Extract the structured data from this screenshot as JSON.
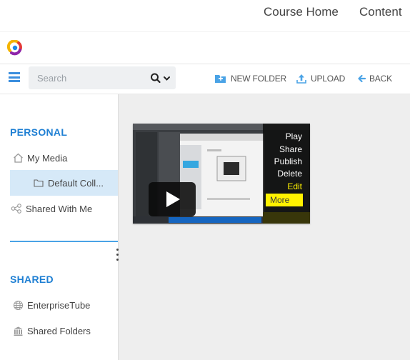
{
  "topnav": {
    "course_home": "Course Home",
    "content": "Content"
  },
  "toolbar": {
    "search_placeholder": "Search",
    "new_folder": "NEW FOLDER",
    "upload": "UPLOAD",
    "back": "BACK"
  },
  "sidebar": {
    "personal_title": "PERSONAL",
    "my_media": "My Media",
    "default_collection": "Default Coll...",
    "shared_with_me": "Shared With Me",
    "shared_title": "SHARED",
    "enterprise_tube": "EnterpriseTube",
    "shared_folders": "Shared Folders"
  },
  "media_tile": {
    "menu": {
      "play": "Play",
      "share": "Share",
      "publish": "Publish",
      "delete": "Delete",
      "edit": "Edit",
      "more": "More"
    }
  },
  "colors": {
    "accent": "#1e7fd3",
    "selected_bg": "#d6e9f8",
    "highlight_yellow": "#fff200",
    "main_bg": "#eeeeee"
  },
  "icons": [
    "app-logo-icon",
    "hamburger-icon",
    "search-icon",
    "chevron-down-icon",
    "new-folder-icon",
    "upload-icon",
    "back-arrow-icon",
    "home-icon",
    "folder-icon",
    "share-icon",
    "globe-icon",
    "building-icon",
    "kebab-icon",
    "play-icon"
  ]
}
